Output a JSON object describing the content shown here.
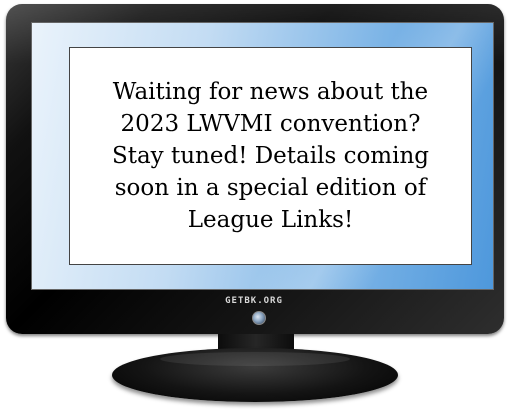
{
  "screen": {
    "message": "Waiting for news about the\n2023 LWVMI convention?\nStay tuned!  Details coming\nsoon in a special edition of\nLeague Links!"
  },
  "monitor": {
    "brand_label": "GETBK.ORG"
  },
  "colors": {
    "bezel": "#000000",
    "screen_blue": "#4e98dc",
    "screen_light": "#eaf3fb",
    "message_bg": "#ffffff"
  }
}
